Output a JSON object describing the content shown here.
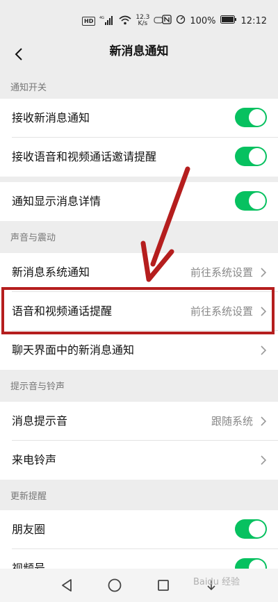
{
  "status_bar": {
    "network_badge": "HD",
    "signal_type": "4G",
    "speed_value": "12.3",
    "speed_unit": "K/s",
    "battery": "100%",
    "time": "12:12"
  },
  "header": {
    "title": "新消息通知"
  },
  "sections": {
    "notify": {
      "header": "通知开关",
      "receive_new": "接收新消息通知",
      "receive_call": "接收语音和视频通话邀请提醒",
      "show_details": "通知显示消息详情"
    },
    "sound": {
      "header": "声音与震动",
      "new_message_system": "新消息系统通知",
      "new_message_system_value": "前往系统设置",
      "call_reminder": "语音和视频通话提醒",
      "call_reminder_value": "前往系统设置",
      "chat_new_message": "聊天界面中的新消息通知"
    },
    "ringtone": {
      "header": "提示音与铃声",
      "message_tone": "消息提示音",
      "message_tone_value": "跟随系统",
      "incoming_ringtone": "来电铃声"
    },
    "updates": {
      "header": "更新提醒",
      "moments": "朋友圈",
      "channels": "视频号"
    }
  },
  "watermark": "Baidu 经验",
  "colors": {
    "toggle_on": "#07c160",
    "annotation": "#b51e1e",
    "background": "#ededed"
  }
}
